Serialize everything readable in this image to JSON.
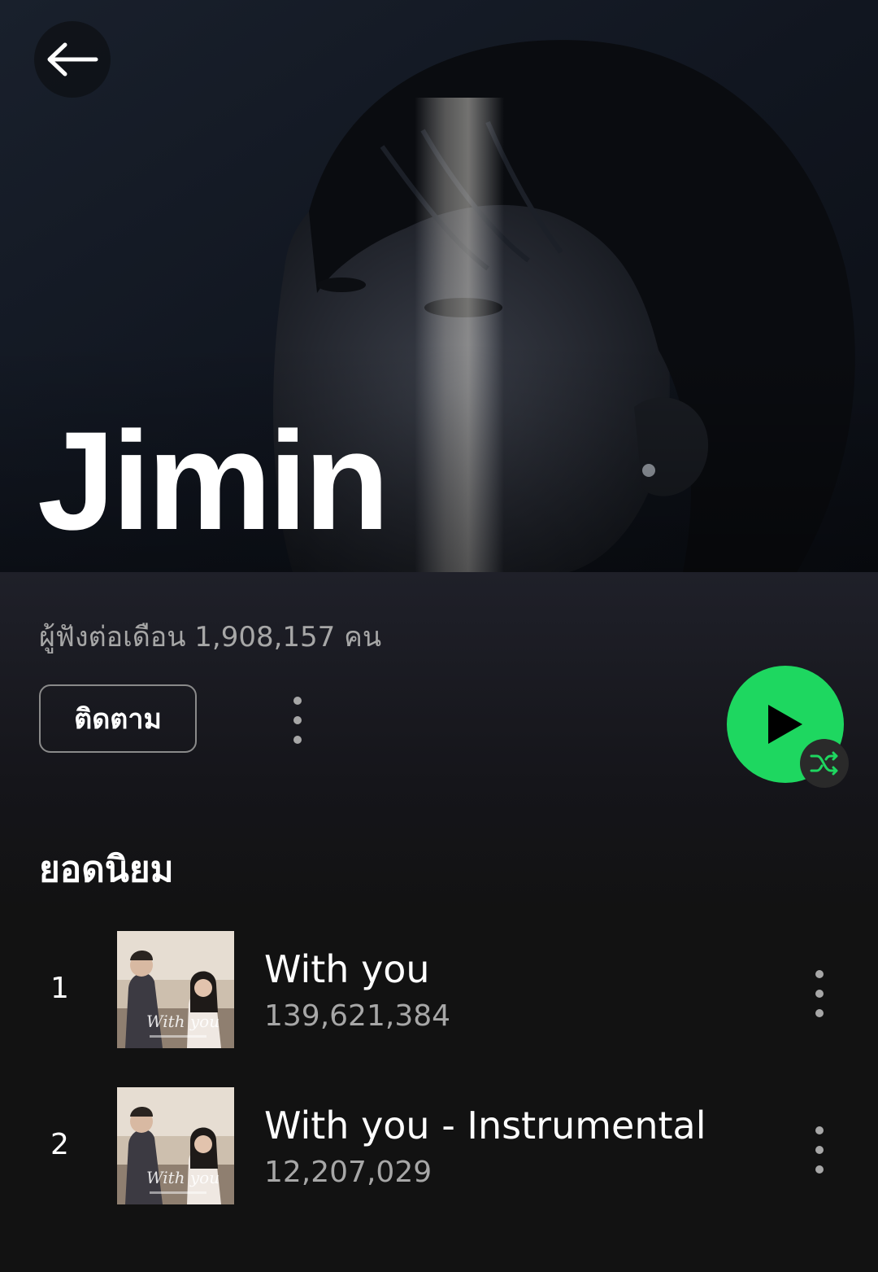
{
  "header": {
    "back_icon": "arrow-left-icon",
    "artist_name": "Jimin"
  },
  "stats": {
    "monthly_listeners": "ผู้ฟังต่อเดือน 1,908,157 คน"
  },
  "actions": {
    "follow_label": "ติดตาม",
    "more_icon": "more-vertical-icon",
    "play_icon": "play-icon",
    "shuffle_icon": "shuffle-icon"
  },
  "popular": {
    "title": "ยอดนิยม",
    "tracks": [
      {
        "rank": "1",
        "title": "With you",
        "plays": "139,621,384"
      },
      {
        "rank": "2",
        "title": "With you - Instrumental",
        "plays": "12,207,029"
      }
    ]
  },
  "colors": {
    "accent": "#1ed760",
    "background": "#121212",
    "secondary_text": "#a7a7a7"
  }
}
